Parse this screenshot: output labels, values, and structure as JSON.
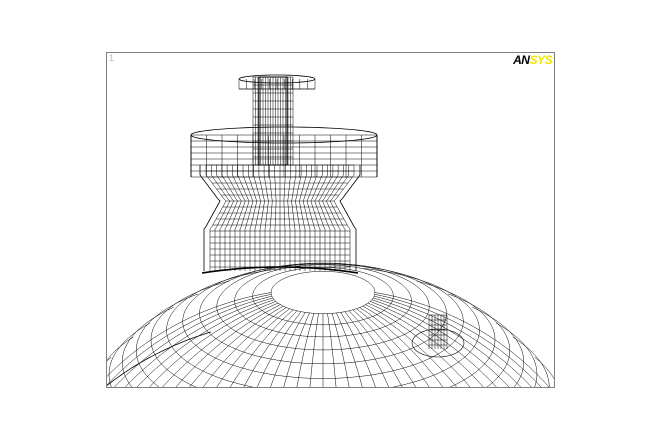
{
  "graphics_window": {
    "window_number": "1",
    "logo": {
      "part_a": "AN",
      "part_b": "SYS",
      "color_a": "#000000",
      "color_b": "#f2e600"
    },
    "background_color": "#ffffff",
    "frame_color": "#7f7f7f"
  }
}
